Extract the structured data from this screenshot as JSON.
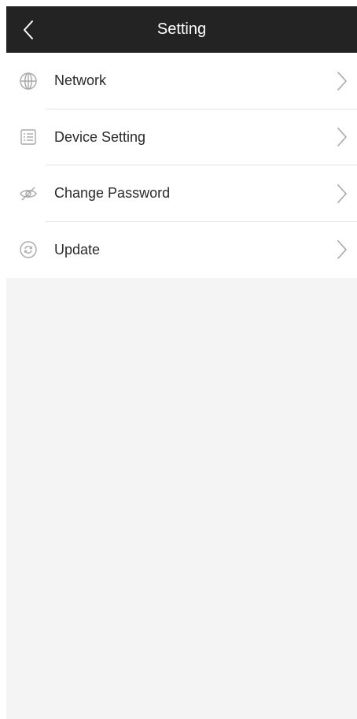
{
  "header": {
    "title": "Setting",
    "back_icon": "chevron-left-icon",
    "background": "#232323"
  },
  "menu": {
    "items": [
      {
        "label": "Network",
        "icon": "globe-icon"
      },
      {
        "label": "Device Setting",
        "icon": "list-icon"
      },
      {
        "label": "Change Password",
        "icon": "eye-off-icon"
      },
      {
        "label": "Update",
        "icon": "refresh-icon"
      }
    ],
    "chevron_icon": "chevron-right-icon"
  },
  "colors": {
    "header_bg": "#232323",
    "page_bg": "#f4f4f4",
    "item_bg": "#ffffff",
    "icon": "#a8a8a8",
    "text": "#2b2b2b"
  }
}
